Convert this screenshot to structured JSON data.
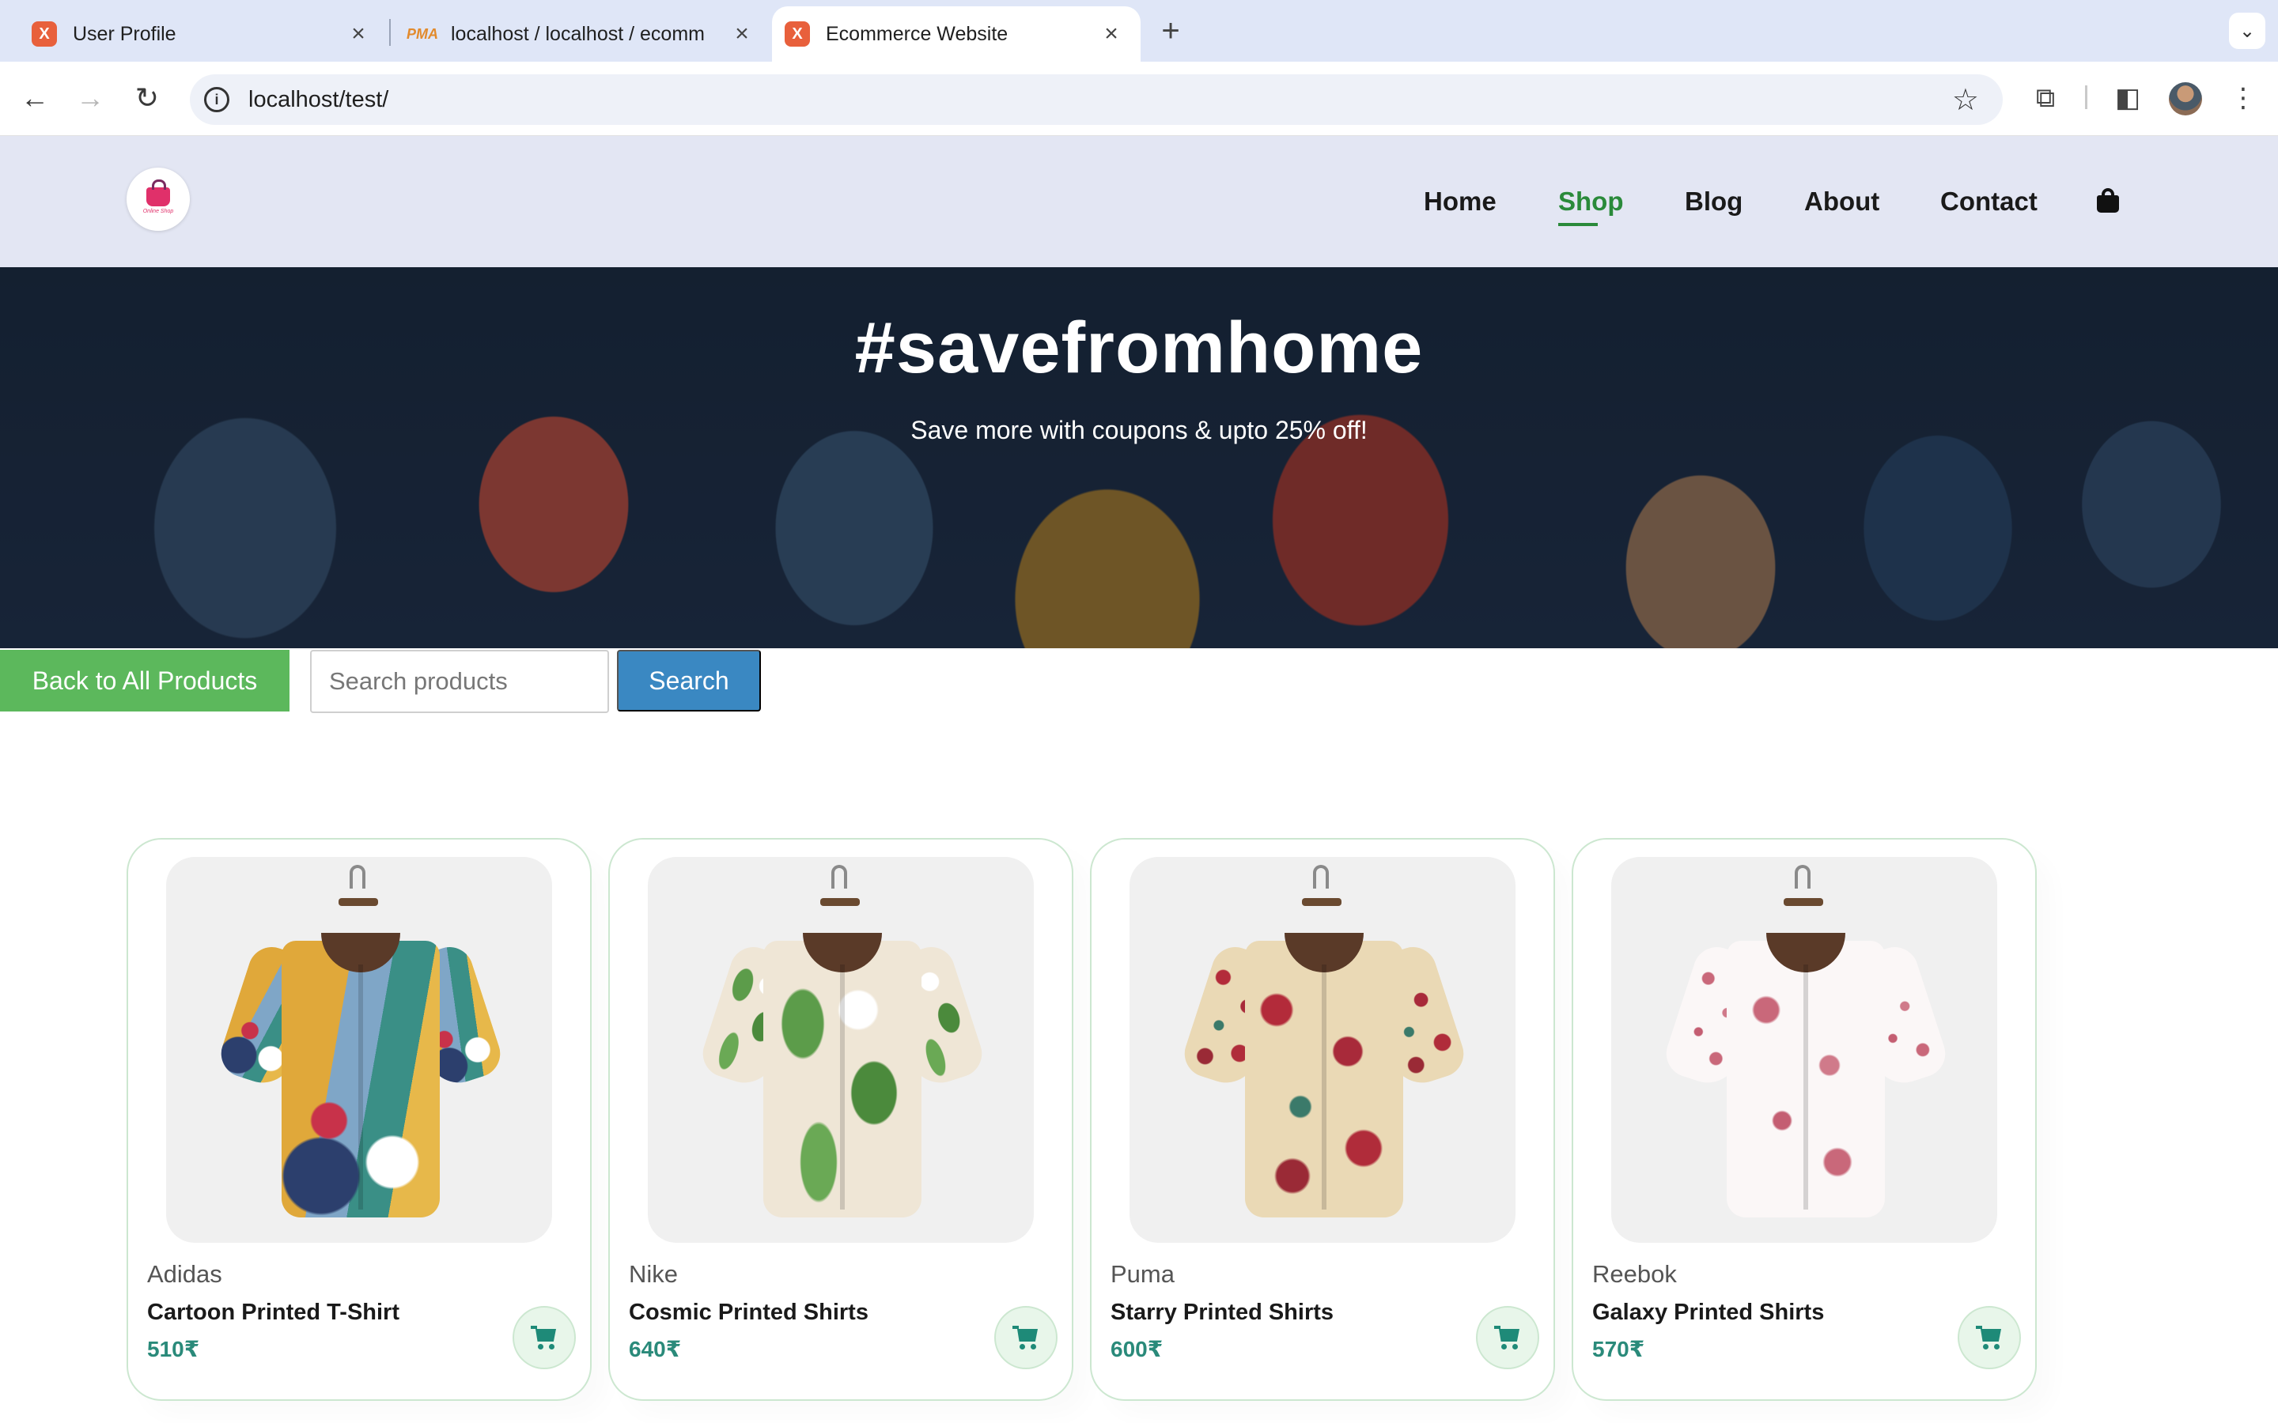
{
  "browser": {
    "tabs": [
      {
        "title": "User Profile",
        "icon": "xampp-icon"
      },
      {
        "title": "localhost / localhost / ecomm",
        "icon": "phpmyadmin-icon"
      },
      {
        "title": "Ecommerce Website",
        "icon": "xampp-icon"
      }
    ],
    "favicon_pma": "PMA",
    "favicon_xampp": "X",
    "url": "localhost/test/"
  },
  "site": {
    "logo_text": "Online Shop",
    "nav": [
      "Home",
      "Shop",
      "Blog",
      "About",
      "Contact"
    ],
    "active_nav": "Shop",
    "accent_color": "#2a8a3a"
  },
  "hero": {
    "title": "#savefromhome",
    "subtitle": "Save more with coupons & upto 25% off!"
  },
  "controls": {
    "back_label": "Back to All Products",
    "search_placeholder": "Search products",
    "search_label": "Search"
  },
  "products": [
    {
      "brand": "Adidas",
      "name": "Cartoon Printed T-Shirt",
      "price": "510₹"
    },
    {
      "brand": "Nike",
      "name": "Cosmic Printed Shirts",
      "price": "640₹"
    },
    {
      "brand": "Puma",
      "name": "Starry Printed Shirts",
      "price": "600₹"
    },
    {
      "brand": "Reebok",
      "name": "Galaxy Printed Shirts",
      "price": "570₹"
    }
  ]
}
